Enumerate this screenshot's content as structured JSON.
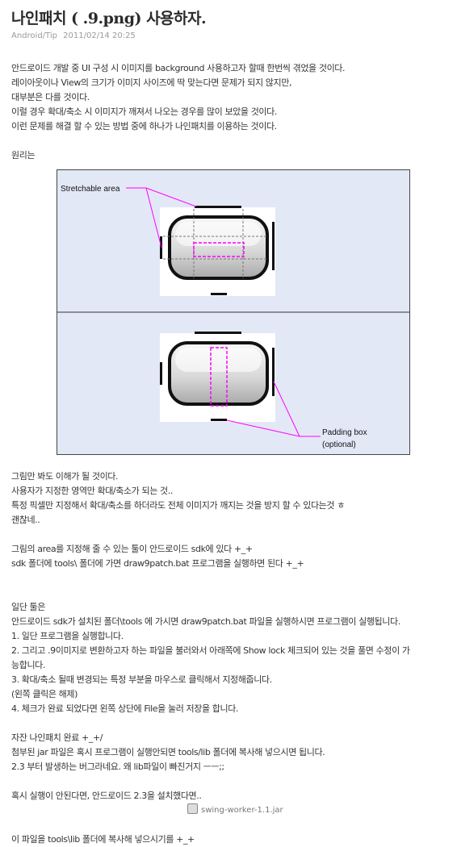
{
  "post": {
    "title": "나인패치 ( .9.png) 사용하자.",
    "category": "Android/Tip",
    "date": "2011/02/14 20:25"
  },
  "paragraphs1": [
    "안드로이드 개발 중 UI 구성 시 이미지를 background 사용하고자 할때 한번씩 겪었을 것이다.",
    "레이아웃이나 View의 크기가 이미지 사이즈에 딱 맞는다면 문제가 되지 않지만,",
    "대부분은 다를 것이다.",
    "이럴 경우 확대/축소 시 이미지가 깨져서 나오는 경우를 많이 보았을 것이다.",
    "이런 문제를 해결 할 수 있는 방법 중에 하나가 나인패치를 이용하는 것이다."
  ],
  "principle_label": "원리는",
  "figure": {
    "stretchable_label": "Stretchable area",
    "padding_label_1": "Padding box",
    "padding_label_2": "(optional)"
  },
  "paragraphs2": [
    "그림만 봐도 이해가 될 것이다.",
    "사용자가 지정한 영역만 확대/축소가 되는 것..",
    "특정 픽셀만 지정해서 확대/축소를 하더라도 전체 이미지가 깨지는 것을 방지 할 수 있다는것 ㅎ",
    "괜찮네.."
  ],
  "paragraphs3": [
    "그림의 area를 지정해 줄 수 있는 툴이 안드로이드 sdk에 있다 +_+",
    "sdk 폴더에 tools\\ 폴더에 가면 draw9patch.bat 프로그램을 실행하면 된다 +_+"
  ],
  "paragraphs4": [
    "일단 툴은",
    "안드로이드 sdk가 설치된 폴더\\tools 에 가시면 draw9patch.bat 파일을 실행하시면 프로그램이 실행됩니다.",
    "1. 일단 프로그램을 실행합니다.",
    "2. 그리고 .9이미지로 변환하고자 하는 파일을 불러와서 아래쪽에 Show lock 체크되어 있는 것을 풀면 수정이 가",
    "능합니다.",
    "3. 확대/축소 될때 변경되는 특정 부분을 마우스로 클릭해서 지정해줍니다.",
    "(왼쪽 클릭은 해제)",
    "4. 체크가 완료 되었다면 왼쪽 상단에 File을 눌러 저장을 합니다."
  ],
  "paragraphs5": [
    "자잔 나인패치 완료 +_+/",
    "첨부된 jar 파일은 혹시 프로그램이 실행안되면 tools/lib 폴더에 복사해 넣으시면 됩니다.",
    "2.3 부터 발생하는 버그라네요. 왜 lib파일이 빠진거지 ㅡㅡ;;"
  ],
  "paragraph6": "혹시 실행이 안된다면, 안드로이드 2.3을 설치했다면..",
  "attachment": "swing-worker-1.1.jar",
  "paragraph7": "이 파일을 tools\\lib 폴더에 복사해 넣으시기를 +_+"
}
